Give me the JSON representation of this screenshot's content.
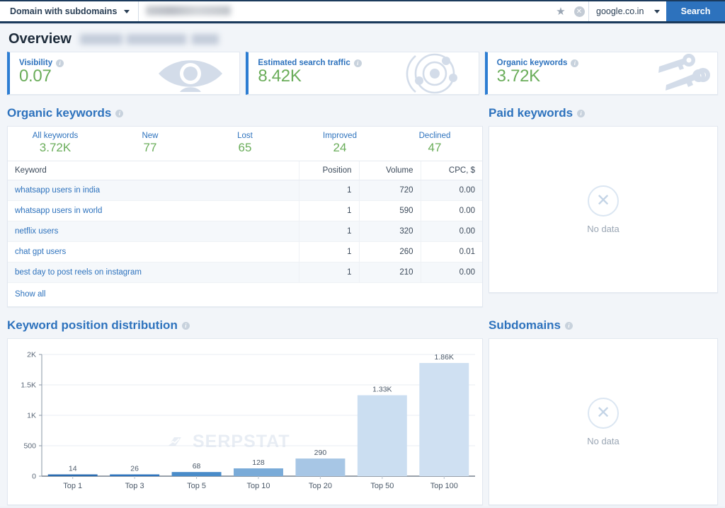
{
  "topbar": {
    "mode_label": "Domain with subdomains",
    "search_value": "",
    "search_placeholder": "",
    "favorite_icon": "star-icon",
    "clear_icon": "clear-icon",
    "database": "google.co.in",
    "search_button": "Search"
  },
  "overview": {
    "title": "Overview",
    "cards": [
      {
        "label": "Visibility",
        "value": "0.07",
        "icon": "eye-icon"
      },
      {
        "label": "Estimated search traffic",
        "value": "8.42K",
        "icon": "network-icon"
      },
      {
        "label": "Organic keywords",
        "value": "3.72K",
        "icon": "keys-icon"
      }
    ]
  },
  "organic": {
    "title": "Organic keywords",
    "stats": [
      {
        "label": "All keywords",
        "value": "3.72K"
      },
      {
        "label": "New",
        "value": "77"
      },
      {
        "label": "Lost",
        "value": "65"
      },
      {
        "label": "Improved",
        "value": "24"
      },
      {
        "label": "Declined",
        "value": "47"
      }
    ],
    "columns": [
      "Keyword",
      "Position",
      "Volume",
      "CPC, $"
    ],
    "rows": [
      {
        "keyword": "whatsapp users in india",
        "position": "1",
        "volume": "720",
        "cpc": "0.00"
      },
      {
        "keyword": "whatsapp users in world",
        "position": "1",
        "volume": "590",
        "cpc": "0.00"
      },
      {
        "keyword": "netflix users",
        "position": "1",
        "volume": "320",
        "cpc": "0.00"
      },
      {
        "keyword": "chat gpt users",
        "position": "1",
        "volume": "260",
        "cpc": "0.01"
      },
      {
        "keyword": "best day to post reels on instagram",
        "position": "1",
        "volume": "210",
        "cpc": "0.00"
      }
    ],
    "show_all": "Show all"
  },
  "paid": {
    "title": "Paid keywords",
    "empty_text": "No data",
    "empty_icon": "circle-x-icon"
  },
  "subdomains": {
    "title": "Subdomains",
    "empty_text": "No data",
    "empty_icon": "circle-x-icon"
  },
  "distribution": {
    "title": "Keyword position distribution",
    "watermark": "SERPSTAT"
  },
  "chart_data": {
    "type": "bar",
    "title": "Keyword position distribution",
    "categories": [
      "Top 1",
      "Top 3",
      "Top 5",
      "Top 10",
      "Top 20",
      "Top 50",
      "Top 100"
    ],
    "values": [
      14,
      26,
      68,
      128,
      290,
      1330,
      1860
    ],
    "labels": [
      "14",
      "26",
      "68",
      "128",
      "290",
      "1.33K",
      "1.86K"
    ],
    "colors": [
      "#2b6cb0",
      "#2f74bd",
      "#4a8cc9",
      "#7aabd8",
      "#a7c6e5",
      "#cbdef1",
      "#cfe0f2"
    ],
    "xlabel": "",
    "ylabel": "",
    "ylim": [
      0,
      2000
    ],
    "yticks": [
      0,
      500,
      1000,
      1500,
      2000
    ],
    "ytick_labels": [
      "0",
      "500",
      "1K",
      "1.5K",
      "2K"
    ],
    "grid": true,
    "legend": false
  }
}
